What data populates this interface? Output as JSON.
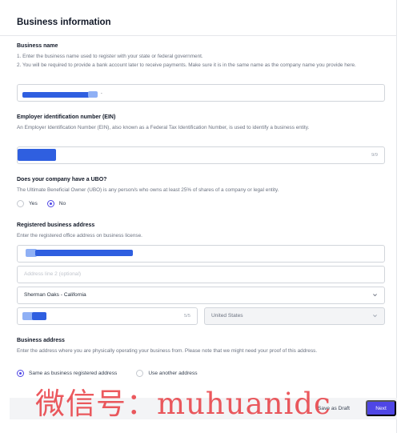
{
  "page": {
    "title": "Business information"
  },
  "business_name": {
    "label": "Business name",
    "help_1": "1. Enter the business name used to register with your state or federal government.",
    "help_2": "2. You will be required to provide a bank account later to receive payments. Make sure it is in the same name as the company name you provide here.",
    "value_suffix": "."
  },
  "ein": {
    "label": "Employer identification number (EIN)",
    "help": "An Employer Identification Number (EIN), also known as a Federal Tax Identification Number, is used to identify a business entity.",
    "count": "9/9"
  },
  "ubo": {
    "label": "Does your company have a UBO?",
    "help": "The Ultimate Beneficial Owner (UBO) is any person/s who owns at least 25% of shares of a company or legal entity.",
    "options": [
      "Yes",
      "No"
    ],
    "selected": "No"
  },
  "registered_address": {
    "label": "Registered business address",
    "help": "Enter the registered office address on business license.",
    "line2_placeholder": "Address line 2 (optional)",
    "city_state": "Sherman Oaks - California",
    "zip_count": "5/5",
    "country": "United States"
  },
  "business_address": {
    "label": "Business address",
    "help": "Enter the address where you are physically operating your business from. Please note that we might need your proof of this address.",
    "options": [
      "Same as business registered address",
      "Use another address"
    ],
    "selected": "Same as business registered address"
  },
  "footer": {
    "save_draft": "Save as Draft",
    "next": "Next"
  },
  "watermark": "微信号：muhuanidc",
  "colors": {
    "accent": "#4f46e5",
    "redaction": "#2f5fe0",
    "watermark": "#e8353b"
  }
}
